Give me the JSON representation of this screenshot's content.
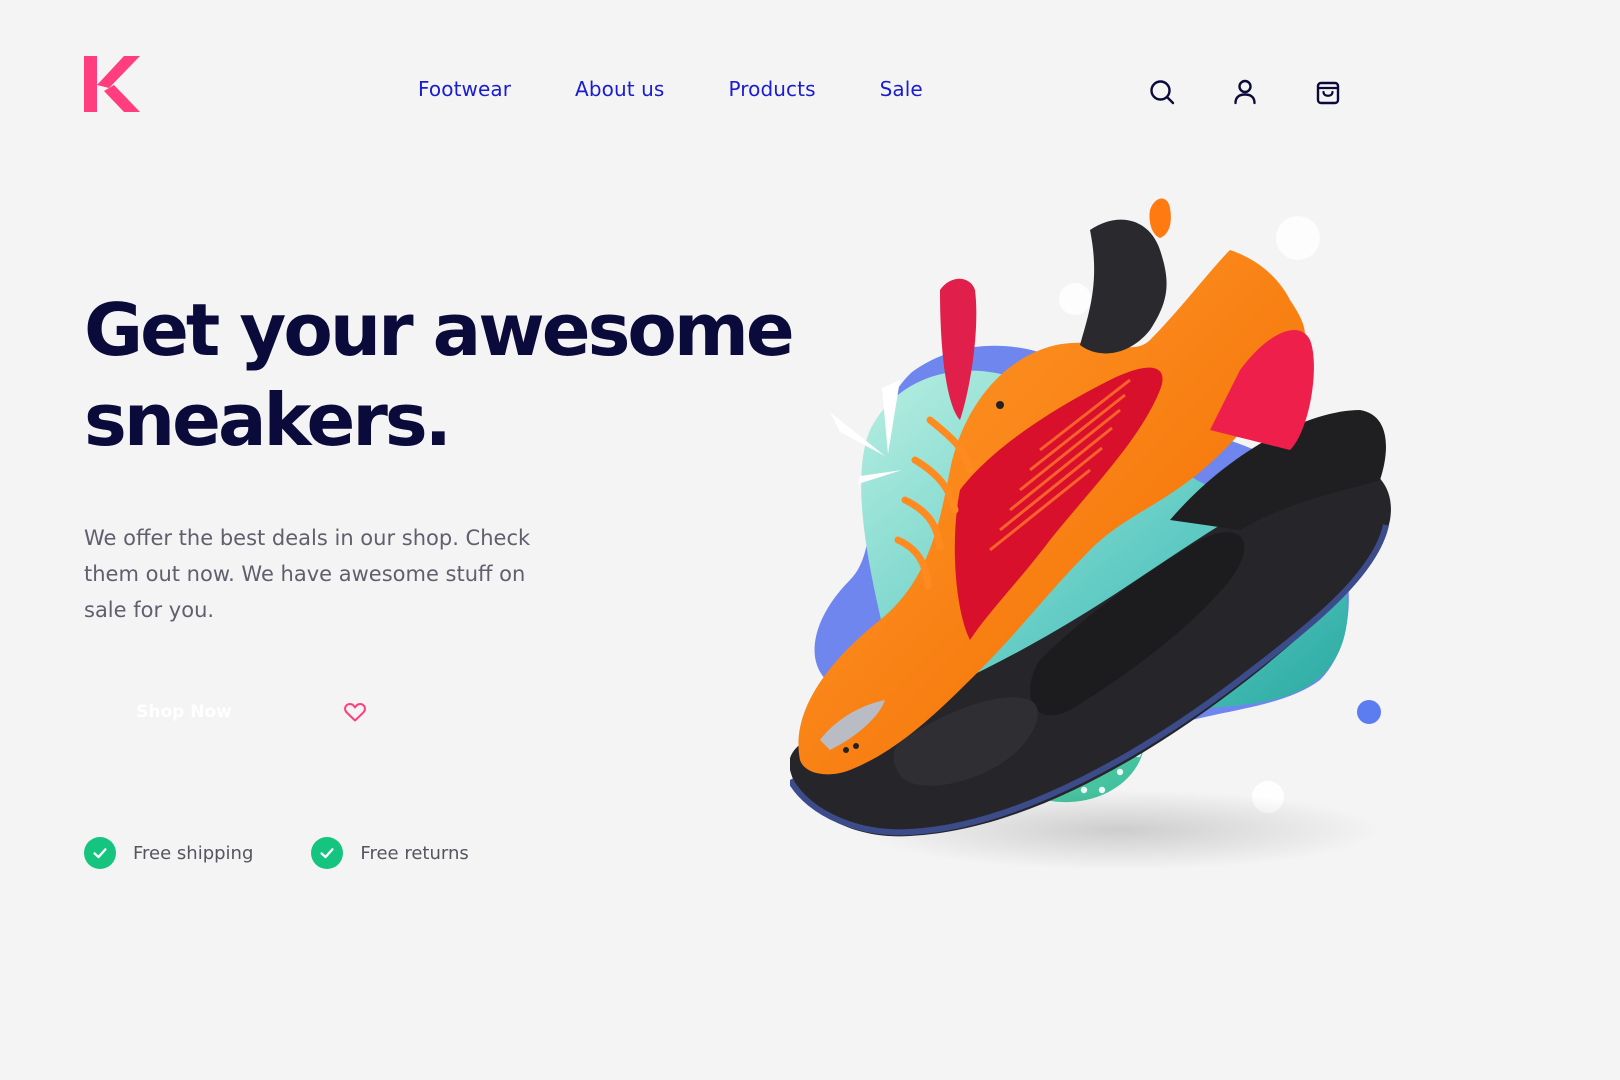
{
  "brand": {
    "logo_letter": "K",
    "logo_color": "#ff3d7f"
  },
  "nav": {
    "items": [
      {
        "label": "Footwear"
      },
      {
        "label": "About us"
      },
      {
        "label": "Products"
      },
      {
        "label": "Sale"
      }
    ],
    "color": "#1a1ccf"
  },
  "header_icons": [
    "search-icon",
    "user-icon",
    "shopping-bag-icon"
  ],
  "hero": {
    "headline_line1": "Get your awesome",
    "headline_line2": "sneakers.",
    "subtext": "We offer the best deals in our shop. Check them out now. We have awesome stuff on sale for you.",
    "cta_label": "Shop Now",
    "favorite_icon": "heart-icon",
    "accent_color": "#ff3d7f"
  },
  "perks": [
    {
      "label": "Free shipping",
      "icon": "check-icon"
    },
    {
      "label": "Free returns",
      "icon": "check-icon"
    }
  ],
  "colors": {
    "background": "#f4f4f4",
    "headline": "#0b0b3b",
    "body_text": "#5f5f6e",
    "check_green": "#15c47e",
    "blob_blue": "#6f86ef",
    "blob_teal": "#25aca0",
    "shoe_orange": "#ff7b12"
  }
}
